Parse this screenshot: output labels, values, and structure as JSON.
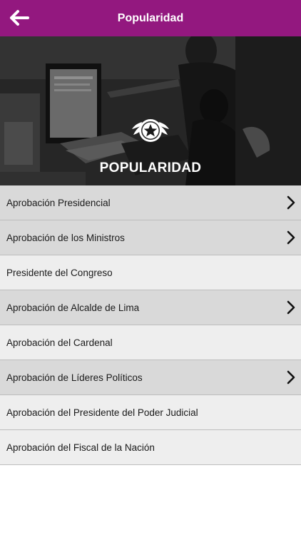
{
  "header": {
    "title": "Popularidad",
    "back_icon": "arrow-left-icon",
    "bar_color": "#93187f"
  },
  "hero": {
    "title": "POPULARIDAD",
    "badge_icon": "star-badge-icon"
  },
  "list": {
    "items": [
      {
        "label": "Aprobación Presidencial",
        "has_chevron": true
      },
      {
        "label": "Aprobación de los Ministros",
        "has_chevron": true
      },
      {
        "label": "Presidente del Congreso",
        "has_chevron": false
      },
      {
        "label": "Aprobación de Alcalde de Lima",
        "has_chevron": true
      },
      {
        "label": "Aprobación del Cardenal",
        "has_chevron": false
      },
      {
        "label": "Aprobación de Líderes Políticos",
        "has_chevron": true
      },
      {
        "label": "Aprobación del Presidente del Poder Judicial",
        "has_chevron": false
      },
      {
        "label": "Aprobación del Fiscal de la Nación",
        "has_chevron": false
      }
    ]
  }
}
